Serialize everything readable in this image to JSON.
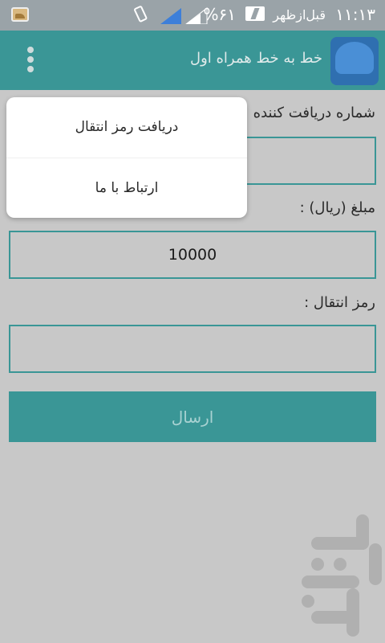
{
  "status_bar": {
    "time": "۱۱:۱۳",
    "ampm": "قبل‌ازظهر",
    "battery_percent": "%۶۱",
    "icons": [
      "gallery-notification-icon",
      "vibrate-icon",
      "signal-icon",
      "battery-charging-icon"
    ]
  },
  "app_bar": {
    "title": "خط به خط همراه اول",
    "logo_icon": "app-logo-icon",
    "menu_icon": "overflow-menu-icon"
  },
  "form": {
    "receiver_label": "شماره دریافت کننده :",
    "receiver_value": "",
    "amount_label": "مبلغ (ریال) :",
    "amount_value": "10000",
    "pin_label": "رمز انتقال :",
    "pin_value": "",
    "send_label": "ارسال"
  },
  "popup_menu": {
    "items": [
      {
        "label": "دریافت رمز انتقال"
      },
      {
        "label": "ارتباط با ما"
      }
    ]
  },
  "colors": {
    "primary": "#3a9696",
    "background": "#c8c8c8",
    "status_bar": "#9aa3a8"
  }
}
